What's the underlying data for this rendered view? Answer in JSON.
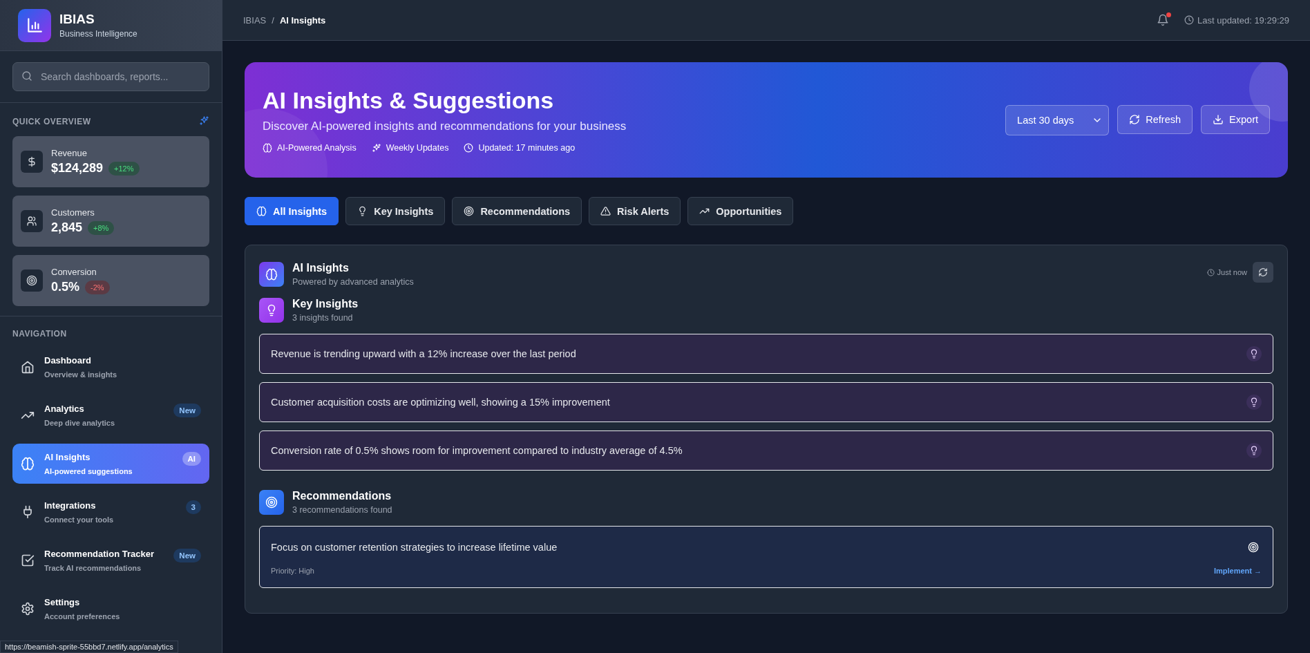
{
  "brand": {
    "name": "IBIAS",
    "tagline": "Business Intelligence"
  },
  "search": {
    "placeholder": "Search dashboards, reports..."
  },
  "quick_overview": {
    "title": "QUICK OVERVIEW",
    "stats": [
      {
        "kind": "dollar",
        "label": "Revenue",
        "value": "$124,289",
        "change": "+12%",
        "negative": false
      },
      {
        "kind": "users",
        "label": "Customers",
        "value": "2,845",
        "change": "+8%",
        "negative": false
      },
      {
        "kind": "target",
        "label": "Conversion",
        "value": "0.5%",
        "change": "-2%",
        "negative": true
      }
    ]
  },
  "navigation": {
    "title": "NAVIGATION",
    "items": [
      {
        "kind": "home",
        "label": "Dashboard",
        "subtitle": "Overview & insights",
        "selected": false
      },
      {
        "kind": "trend",
        "label": "Analytics",
        "subtitle": "Deep dive analytics",
        "badge": "New",
        "selected": false
      },
      {
        "kind": "brain",
        "label": "AI Insights",
        "subtitle": "AI-powered suggestions",
        "badge": "AI",
        "selected": true
      },
      {
        "kind": "plug",
        "label": "Integrations",
        "subtitle": "Connect your tools",
        "badge": "3",
        "selected": false
      },
      {
        "kind": "check",
        "label": "Recommendation Tracker",
        "subtitle": "Track AI recommendations",
        "badge": "New",
        "selected": false
      },
      {
        "kind": "gear",
        "label": "Settings",
        "subtitle": "Account preferences",
        "selected": false
      }
    ]
  },
  "status_url": "https://beamish-sprite-55bbd7.netlify.app/analytics",
  "breadcrumb": {
    "separator": "/",
    "items": [
      "IBIAS",
      "AI Insights"
    ]
  },
  "header": {
    "unread": true,
    "last_updated": "Last updated: 19:29:29"
  },
  "hero": {
    "title": "AI Insights & Suggestions",
    "subtitle": "Discover AI-powered insights and recommendations for your business",
    "features": [
      {
        "kind": "brain",
        "text": "AI-Powered Analysis"
      },
      {
        "kind": "sparkles",
        "text": "Weekly Updates"
      },
      {
        "kind": "clock",
        "text": "Updated: 17 minutes ago"
      }
    ],
    "period": "Last 30 days",
    "buttons": [
      {
        "kind": "refresh",
        "label": "Refresh"
      },
      {
        "kind": "download",
        "label": "Export"
      }
    ]
  },
  "tabs": [
    {
      "kind": "brain",
      "label": "All Insights",
      "selected": true
    },
    {
      "kind": "bulb",
      "label": "Key Insights",
      "selected": false
    },
    {
      "kind": "target",
      "label": "Recommendations",
      "selected": false
    },
    {
      "kind": "alert",
      "label": "Risk Alerts",
      "selected": false
    },
    {
      "kind": "trend",
      "label": "Opportunities",
      "selected": false
    }
  ],
  "panel": {
    "title": "AI Insights",
    "subtitle": "Powered by advanced analytics",
    "timestamp": "Just now",
    "sections": [
      {
        "kind": "insights",
        "title": "Key Insights",
        "count": "3 insights found",
        "items": [
          {
            "text": "Revenue is trending upward with a 12% increase over the last period"
          },
          {
            "text": "Customer acquisition costs are optimizing well, showing a 15% improvement"
          },
          {
            "text": "Conversion rate of 0.5% shows room for improvement compared to industry average of 4.5%"
          }
        ]
      },
      {
        "kind": "recommendations",
        "title": "Recommendations",
        "count": "3 recommendations found",
        "items": [
          {
            "text": "Focus on customer retention strategies to increase lifetime value",
            "priority": "Priority: High",
            "action": "Implement →"
          }
        ]
      }
    ]
  }
}
